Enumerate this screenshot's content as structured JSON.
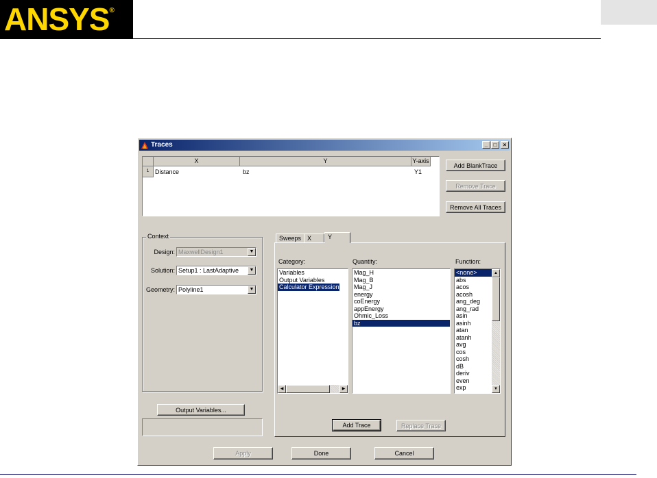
{
  "header": {
    "logo_text": "ANSYS",
    "logo_reg": "®"
  },
  "window": {
    "title": "Traces",
    "minimize": "_",
    "maximize": "□",
    "close": "×"
  },
  "grid": {
    "columns": [
      "X",
      "Y",
      "Y-axis"
    ],
    "rows": [
      {
        "num": "1",
        "x": "Distance",
        "y": "bz",
        "axis": "Y1"
      }
    ]
  },
  "trace_buttons": {
    "add_blank": "Add BlankTrace",
    "remove": "Remove Trace",
    "remove_all": "Remove All Traces"
  },
  "context": {
    "label": "Context",
    "design_label": "Design:",
    "design_value": "MaxwellDesign1",
    "solution_label": "Solution:",
    "solution_value": "Setup1 : LastAdaptive",
    "geometry_label": "Geometry:",
    "geometry_value": "Polyline1"
  },
  "output_variables_button": "Output Variables...",
  "tabs": [
    "Sweeps",
    "X",
    "Y"
  ],
  "category": {
    "label": "Category:",
    "items": [
      "Variables",
      "Output Variables",
      "Calculator Expressions"
    ],
    "selected": 2
  },
  "quantity": {
    "label": "Quantity:",
    "items": [
      "Mag_H",
      "Mag_B",
      "Mag_J",
      "energy",
      "coEnergy",
      "appEnergy",
      "Ohmic_Loss",
      "bz"
    ],
    "selected": 7
  },
  "function": {
    "label": "Function:",
    "items": [
      "<none>",
      "abs",
      "acos",
      "acosh",
      "ang_deg",
      "ang_rad",
      "asin",
      "asinh",
      "atan",
      "atanh",
      "avg",
      "cos",
      "cosh",
      "dB",
      "deriv",
      "even",
      "exp"
    ],
    "selected": 0
  },
  "add_trace": "Add Trace",
  "replace_trace": "Replace Trace",
  "bottom_buttons": {
    "apply": "Apply",
    "done": "Done",
    "cancel": "Cancel"
  },
  "colors": {
    "titlebar": "#0a246a",
    "selection": "#0a246a",
    "logo_fg": "#ffd700",
    "logo_bg": "#000000"
  }
}
